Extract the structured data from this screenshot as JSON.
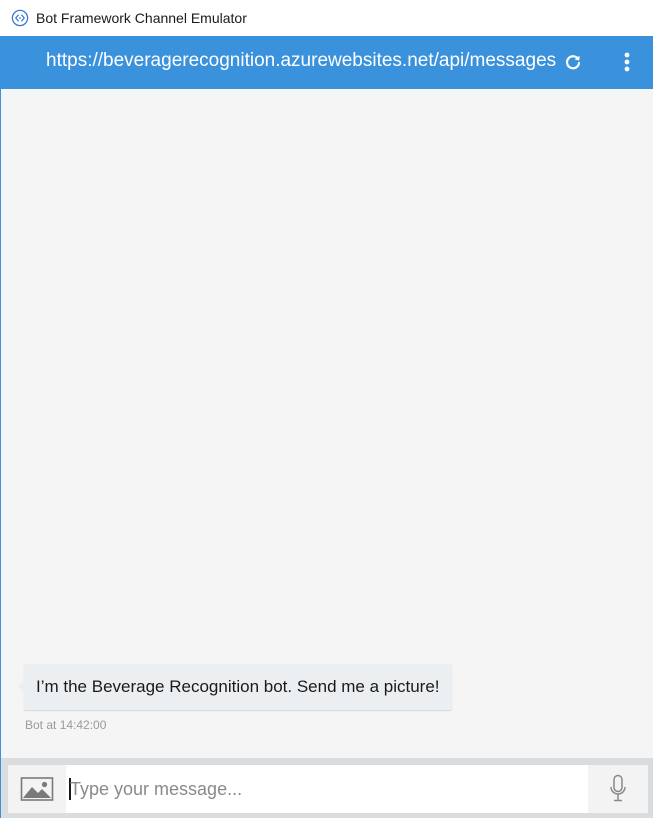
{
  "window": {
    "title": "Bot Framework Channel Emulator",
    "icon": "bot-framework-icon"
  },
  "header": {
    "url": "https://beveragerecognition.azurewebsites.net/api/messages",
    "refresh_icon": "refresh-icon",
    "menu_icon": "vertical-ellipsis-icon",
    "background_color": "#3a91dc"
  },
  "conversation": {
    "messages": [
      {
        "sender": "Bot",
        "text": "I’m the Beverage Recognition bot. Send me a picture!",
        "meta": "Bot at 14:42:00"
      }
    ]
  },
  "composer": {
    "placeholder": "Type your message...",
    "upload_icon": "image-upload-icon",
    "mic_icon": "microphone-icon"
  }
}
